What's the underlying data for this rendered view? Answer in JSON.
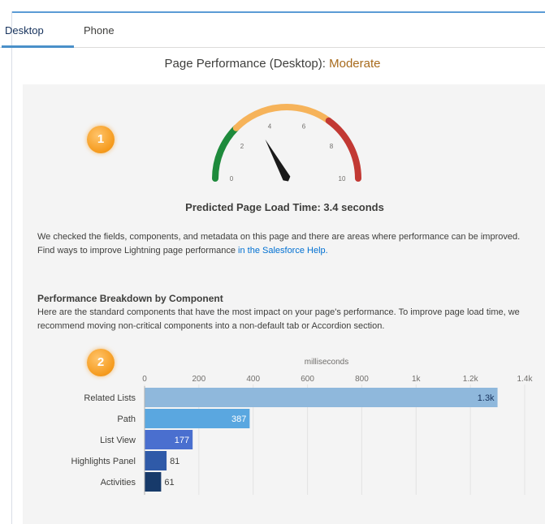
{
  "tabs": [
    {
      "label": "Desktop",
      "active": true
    },
    {
      "label": "Phone",
      "active": false
    }
  ],
  "header": {
    "title_prefix": "Page Performance (Desktop): ",
    "rating": "Moderate",
    "rating_color": "#a76a1c"
  },
  "badges": {
    "one": "1",
    "two": "2"
  },
  "gauge": {
    "ticks": [
      "0",
      "2",
      "4",
      "6",
      "8",
      "10"
    ],
    "value": 3.4,
    "min": 0,
    "max": 10,
    "zone_colors": [
      "#1e8a3c",
      "#f6b35a",
      "#c23934"
    ]
  },
  "prediction": "Predicted Page Load Time: 3.4 seconds",
  "description": {
    "text": "We checked the fields, components, and metadata on this page and there are areas where performance can be improved. Find ways to improve Lightning page performance ",
    "link": "in the Salesforce Help."
  },
  "breakdown": {
    "heading": "Performance Breakdown by Component",
    "text": "Here are the standard components that have the most impact on your page's performance. To improve page load time, we recommend moving non-critical components into a non-default tab or Accordion section."
  },
  "chart_data": {
    "type": "bar",
    "orientation": "horizontal",
    "xlabel": "milliseconds",
    "x_ticks": [
      "0",
      "200",
      "400",
      "600",
      "800",
      "1k",
      "1.2k",
      "1.4k"
    ],
    "xlim": [
      0,
      1400
    ],
    "categories": [
      "Related Lists",
      "Path",
      "List View",
      "Highlights Panel",
      "Activities"
    ],
    "values": [
      1300,
      387,
      177,
      81,
      61
    ],
    "value_labels": [
      "1.3k",
      "387",
      "177",
      "81",
      "61"
    ],
    "colors": [
      "#8fb8dc",
      "#5aa7e0",
      "#4a6fcf",
      "#2f5aa8",
      "#173a6a"
    ]
  }
}
